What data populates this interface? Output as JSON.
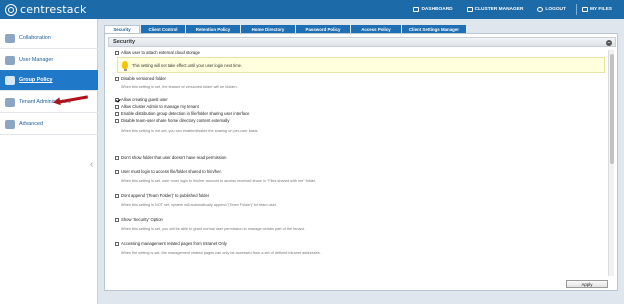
{
  "brand": {
    "name": "centrestack"
  },
  "topnav": [
    {
      "label": "DASHBOARD",
      "icon": "dashboard-icon"
    },
    {
      "label": "CLUSTER MANAGER",
      "icon": "cluster-manager-icon"
    },
    {
      "label": "LOGOUT",
      "icon": "logout-icon"
    },
    {
      "label": "MY FILES",
      "icon": "my-files-icon"
    }
  ],
  "sidebar": {
    "items": [
      {
        "label": "Collaboration",
        "icon": "collaboration-icon"
      },
      {
        "label": "User Manager",
        "icon": "users-icon"
      },
      {
        "label": "Group Policy",
        "icon": "group-policy-icon",
        "active": true
      },
      {
        "label": "Tenant Administrators",
        "icon": "tenant-admin-icon"
      },
      {
        "label": "Advanced",
        "icon": "advanced-chart-icon"
      }
    ]
  },
  "tabs": [
    {
      "label": "Security",
      "active": true
    },
    {
      "label": "Client Control"
    },
    {
      "label": "Retention Policy"
    },
    {
      "label": "Home Directory"
    },
    {
      "label": "Password Policy"
    },
    {
      "label": "Access Policy"
    },
    {
      "label": "Client Settings Manager"
    }
  ],
  "panel": {
    "title": "Security",
    "toggle": "−",
    "warning": "This setting will not take effect until your user login next time.",
    "options": [
      {
        "label": "Allow user to attach external cloud storage",
        "checked": false
      },
      {
        "label": "Disable versioned folder",
        "checked": false
      },
      {
        "label": "Allow creating guest user",
        "checked": true
      },
      {
        "label": "Allow Cluster Admin to manage my tenant",
        "checked": false
      },
      {
        "label": "Enable distribution group detection in file/folder sharing user interface",
        "checked": false
      },
      {
        "label": "Disable team-user share home directory content externally",
        "checked": false
      },
      {
        "label": "Don't show folder that user doesn't have read permission",
        "checked": false
      },
      {
        "label": "User must login to access file/folder shared to him/her.",
        "checked": false
      },
      {
        "label": "Dont append '(Team Folder)' to published folder",
        "checked": false
      },
      {
        "label": "Show 'Security' Option",
        "checked": false
      },
      {
        "label": "Accessing management related pages from Intranet Only",
        "checked": false
      }
    ],
    "descriptions": [
      "When this setting is set, the feature of versioned folder will be hidden.",
      "When this setting is not set, you can enable/disable the sharing on per-user basis.",
      "When this setting is set, user must login to his/her account to access received share in \"Files shared with me\" folder.",
      "When this setting is NOT set, system will automatically append '(Team Folder)' for team user.",
      "When this setting is set, you will be able to grant normal user permission to manage certain part of the tenant.",
      "When the setting is set, the management related pages can only be accessed from a set of defined intranet addresses."
    ]
  },
  "apply_label": "Apply"
}
